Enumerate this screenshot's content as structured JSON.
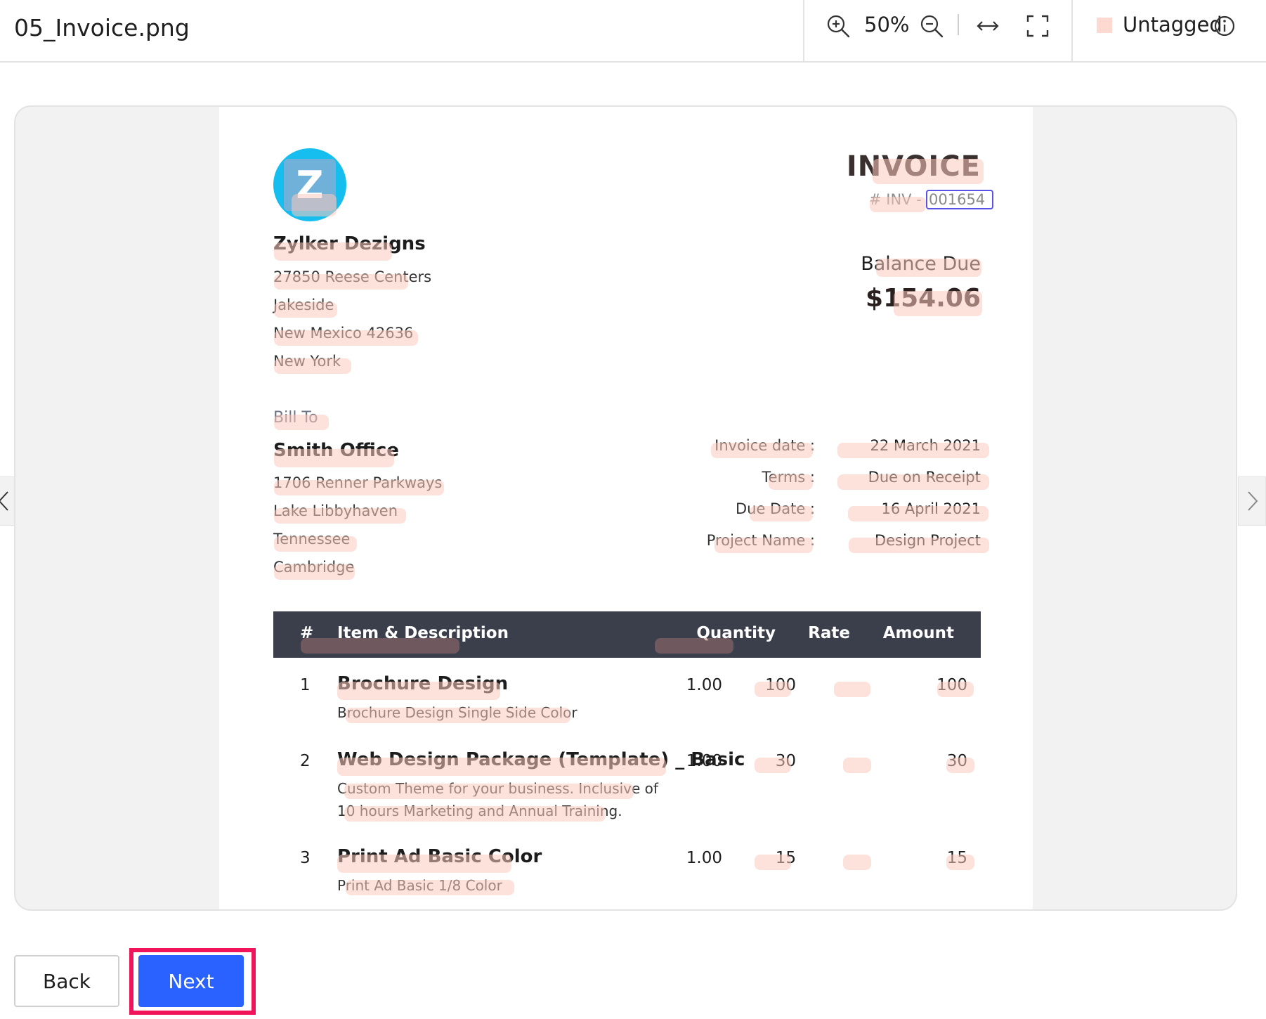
{
  "header": {
    "filename": "05_Invoice.png",
    "zoom": "50%",
    "tag": "Untagged"
  },
  "invoice": {
    "logo_letter": "Z",
    "title": "INVOICE",
    "number_prefix": "# INV -",
    "number": "001654",
    "company": {
      "name": "Zylker Dezigns",
      "address": [
        "27850 Reese Centers",
        "Jakeside",
        "New Mexico 42636",
        "New York"
      ]
    },
    "balance": {
      "label": "Balance Due",
      "amount": "$154.06"
    },
    "bill_to": {
      "label": "Bill To",
      "name": "Smith Office",
      "address": [
        "1706 Renner Parkways",
        "Lake Libbyhaven",
        "Tennessee",
        "Cambridge"
      ]
    },
    "meta": [
      {
        "label": "Invoice date :",
        "value": "22 March 2021"
      },
      {
        "label": "Terms :",
        "value": "Due on Receipt"
      },
      {
        "label": "Due Date :",
        "value": "16 April 2021"
      },
      {
        "label": "Project Name :",
        "value": "Design Project"
      }
    ],
    "columns": {
      "num": "#",
      "item": "Item  & Description",
      "qty": "Quantity",
      "rate": "Rate",
      "amount": "Amount"
    },
    "items": [
      {
        "num": "1",
        "name": "Brochure Design",
        "desc": [
          "Brochure Design Single Side Color"
        ],
        "qty": "1.00",
        "rate": "100",
        "amount": "100"
      },
      {
        "num": "2",
        "name": "Web Design Package (Template) _ Basic",
        "desc": [
          "Custom Theme for your business. Inclusive of",
          "10 hours Marketing and Annual Training."
        ],
        "qty": "1.00",
        "rate": "30",
        "amount": "30"
      },
      {
        "num": "3",
        "name": "Print Ad Basic Color",
        "desc": [
          "Print Ad Basic 1/8 Color"
        ],
        "qty": "1.00",
        "rate": "15",
        "amount": "15"
      }
    ]
  },
  "footer": {
    "back_label": "Back",
    "next_label": "Next"
  },
  "colors": {
    "accent": "#2962ff",
    "highlight_frame": "#f0145a",
    "tag_highlight": "#fdd9d2",
    "table_header": "#3a3f4b",
    "logo": "#16bef0"
  },
  "icons": [
    "zoom-in-icon",
    "zoom-out-icon",
    "fit-width-icon",
    "fullscreen-icon",
    "info-icon",
    "chevron-left-icon",
    "chevron-right-icon"
  ]
}
